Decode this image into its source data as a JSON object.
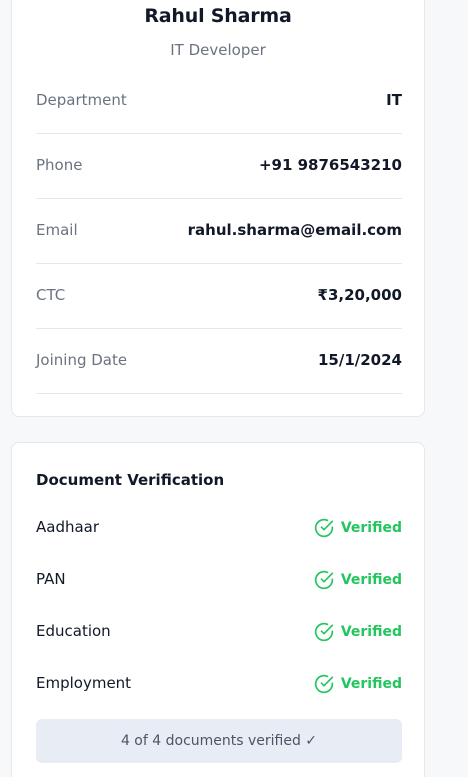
{
  "profile": {
    "name": "Rahul Sharma",
    "role": "IT Developer",
    "fields": [
      {
        "label": "Department",
        "value": "IT"
      },
      {
        "label": "Phone",
        "value": "+91 9876543210"
      },
      {
        "label": "Email",
        "value": "rahul.sharma@email.com"
      },
      {
        "label": "CTC",
        "value": "₹3,20,000"
      },
      {
        "label": "Joining Date",
        "value": "15/1/2024"
      }
    ]
  },
  "documents": {
    "title": "Document Verification",
    "items": [
      {
        "name": "Aadhaar",
        "status": "Verified",
        "icon": "check-circle-icon"
      },
      {
        "name": "PAN",
        "status": "Verified",
        "icon": "check-circle-icon"
      },
      {
        "name": "Education",
        "status": "Verified",
        "icon": "check-circle-icon"
      },
      {
        "name": "Employment",
        "status": "Verified",
        "icon": "check-circle-icon"
      }
    ],
    "summary": "4 of 4 documents verified ✓"
  },
  "colors": {
    "verified": "#22c55e",
    "summary_bg": "#e8edf5"
  }
}
